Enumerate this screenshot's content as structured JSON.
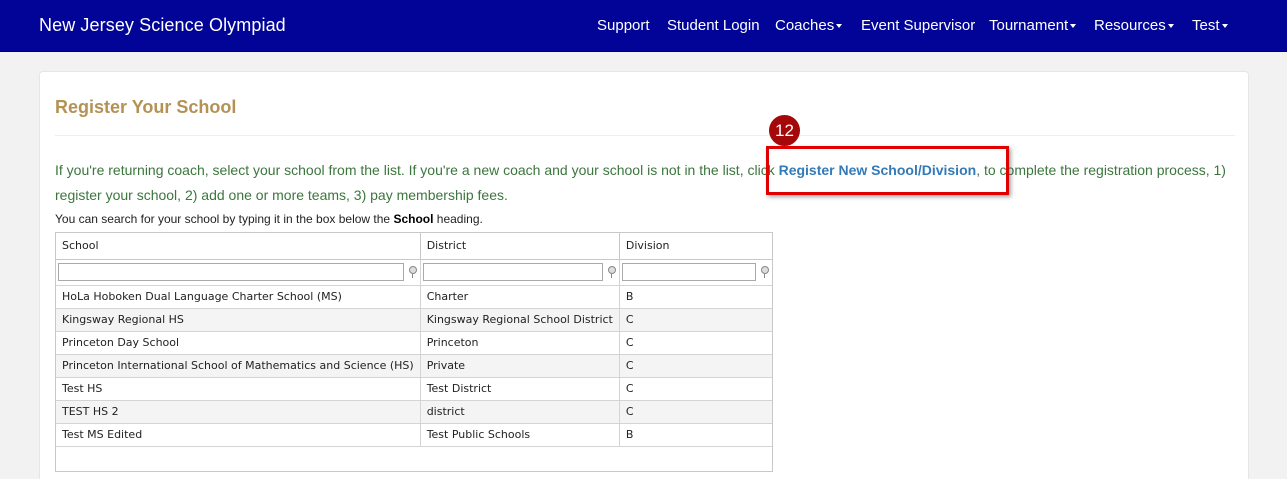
{
  "site": {
    "brand": "New Jersey Science Olympiad",
    "colors": {
      "navbar": "#010497",
      "title": "#b49254",
      "intro_text": "#3c763d",
      "link": "#337ab7",
      "highlight": "#e00000",
      "badge": "#a50808"
    }
  },
  "nav": {
    "support": "Support",
    "student_login": "Student Login",
    "coaches": "Coaches",
    "event_supervisor": "Event Supervisor",
    "tournament": "Tournament",
    "resources": "Resources",
    "test": "Test"
  },
  "page": {
    "title": "Register Your School",
    "intro_before": "If you're returning coach, select your school from the list. If you're a new coach and your school is not in the list, click ",
    "register_link": "Register New School/Division",
    "intro_after": ", to complete the registration process, 1) register your school, 2) add one or more teams, 3) pay membership fees.",
    "hint_before": "You can search for your school by typing it in the box below the ",
    "hint_bold": "School",
    "hint_after": " heading."
  },
  "annotation": {
    "step": "12"
  },
  "grid": {
    "columns": [
      "School",
      "District",
      "Division"
    ],
    "filters": [
      "",
      "",
      ""
    ],
    "rows": [
      [
        "HoLa Hoboken Dual Language Charter School (MS)",
        "Charter",
        "B"
      ],
      [
        "Kingsway Regional HS",
        "Kingsway Regional School District",
        "C"
      ],
      [
        "Princeton Day School",
        "Princeton",
        "C"
      ],
      [
        "Princeton International School of Mathematics and Science (HS)",
        "Private",
        "C"
      ],
      [
        "Test HS",
        "Test District",
        "C"
      ],
      [
        "TEST HS 2",
        "district",
        "C"
      ],
      [
        "Test MS Edited",
        "Test Public Schools",
        "B"
      ]
    ]
  }
}
